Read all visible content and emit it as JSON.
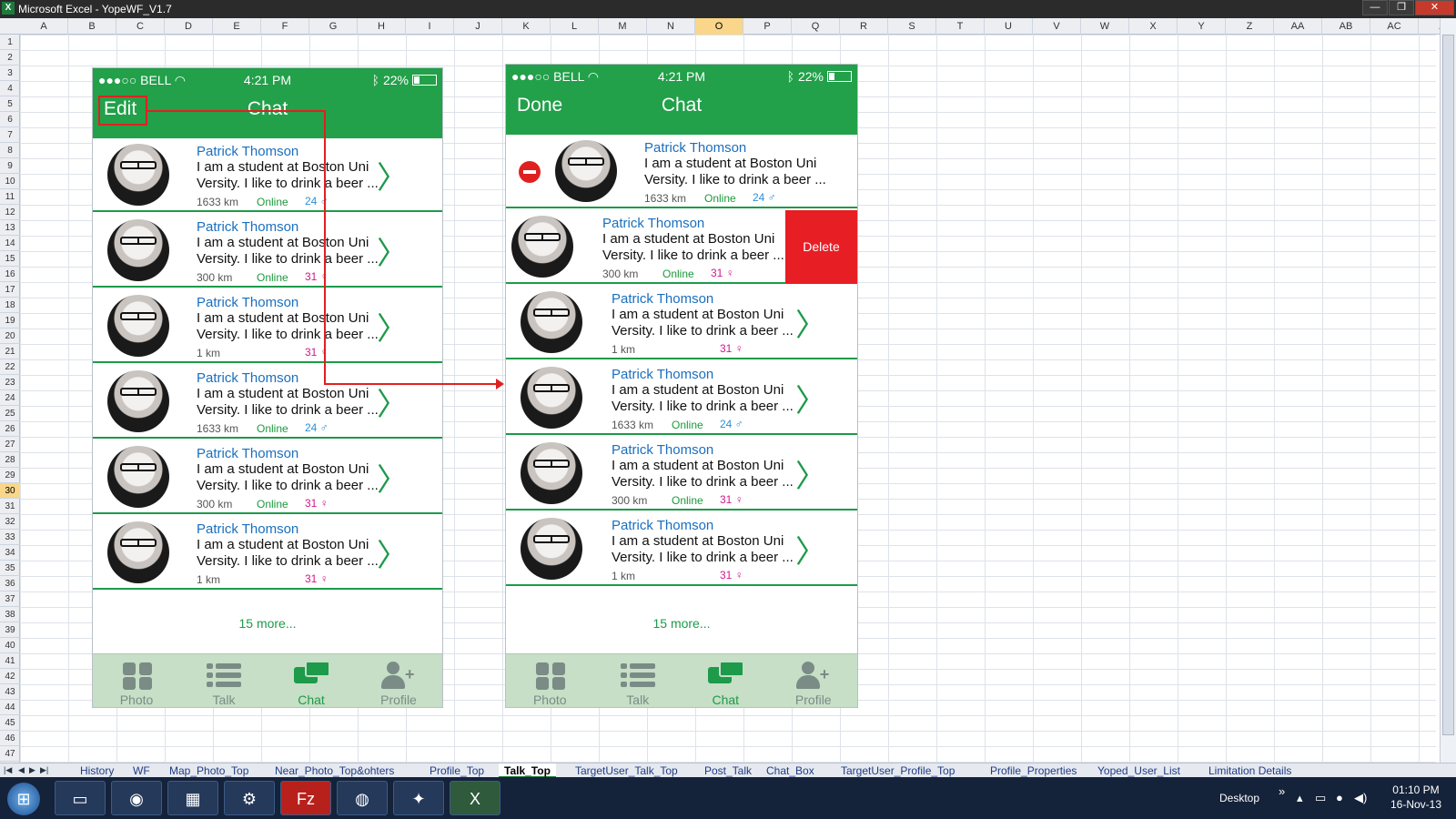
{
  "window": {
    "title": "Microsoft Excel - YopeWF_V1.7",
    "min_label": "—",
    "max_label": "❐",
    "close_label": "✕"
  },
  "spreadsheet": {
    "columns": [
      "A",
      "B",
      "C",
      "D",
      "E",
      "F",
      "G",
      "H",
      "I",
      "J",
      "K",
      "L",
      "M",
      "N",
      "O",
      "P",
      "Q",
      "R",
      "S",
      "T",
      "U",
      "V",
      "W",
      "X",
      "Y",
      "Z",
      "AA",
      "AB",
      "AC",
      "A"
    ],
    "selected_column": "O",
    "rows": [
      "1",
      "2",
      "3",
      "4",
      "5",
      "6",
      "7",
      "8",
      "9",
      "10",
      "11",
      "12",
      "13",
      "14",
      "15",
      "16",
      "17",
      "18",
      "19",
      "20",
      "21",
      "22",
      "23",
      "24",
      "25",
      "26",
      "27",
      "28",
      "29",
      "30",
      "31",
      "32",
      "33",
      "34",
      "35",
      "36",
      "37",
      "38",
      "39",
      "40",
      "41",
      "42",
      "43",
      "44",
      "45",
      "46",
      "47"
    ],
    "selected_row": "30"
  },
  "sheet_tabs": [
    "History",
    "WF",
    "Map_Photo_Top",
    "Near_Photo_Top&ohters",
    "Profile_Top",
    "Talk_Top",
    "TargetUser_Talk_Top",
    "Post_Talk",
    "Chat_Box",
    "TargetUser_Profile_Top",
    "Profile_Properties",
    "Yoped_User_List",
    "Limitation Details"
  ],
  "active_sheet": "Talk_Top",
  "taskbar": {
    "desktop_label": "Desktop",
    "clock_time": "01:10 PM",
    "clock_date": "16-Nov-13"
  },
  "phone_left": {
    "status": {
      "carrier": "●●●○○ BELL",
      "time": "4:21 PM",
      "battery": "22%"
    },
    "nav": {
      "left": "Edit",
      "title": "Chat"
    },
    "rows": [
      {
        "name": "Patrick Thomson",
        "msg1": "I am a student at Boston Uni",
        "msg2": "Versity. I like to drink a beer ...",
        "dist": "1633 km",
        "online": "Online",
        "age": "24 ♂",
        "gender": "m"
      },
      {
        "name": "Patrick Thomson",
        "msg1": "I am a student at Boston Uni",
        "msg2": "Versity. I like to drink a beer ...",
        "dist": "300 km",
        "online": "Online",
        "age": "31 ♀",
        "gender": "f"
      },
      {
        "name": "Patrick Thomson",
        "msg1": "I am a student at Boston Uni",
        "msg2": "Versity. I like to drink a beer ...",
        "dist": "1 km",
        "online": "",
        "age": "31 ♀",
        "gender": "f"
      },
      {
        "name": "Patrick Thomson",
        "msg1": "I am a student at Boston Uni",
        "msg2": "Versity. I like to drink a beer ...",
        "dist": "1633 km",
        "online": "Online",
        "age": "24 ♂",
        "gender": "m"
      },
      {
        "name": "Patrick Thomson",
        "msg1": "I am a student at Boston Uni",
        "msg2": "Versity. I like to drink a beer ...",
        "dist": "300 km",
        "online": "Online",
        "age": "31 ♀",
        "gender": "f"
      },
      {
        "name": "Patrick Thomson",
        "msg1": "I am a student at Boston Uni",
        "msg2": "Versity. I like to drink a beer ...",
        "dist": "1 km",
        "online": "",
        "age": "31 ♀",
        "gender": "f"
      }
    ],
    "more": "15 more...",
    "tabs": [
      "Photo",
      "Talk",
      "Chat",
      "Profile"
    ],
    "active_tab": "Chat"
  },
  "phone_right": {
    "status": {
      "carrier": "●●●○○ BELL",
      "time": "4:21 PM",
      "battery": "22%"
    },
    "nav": {
      "left": "Done",
      "title": "Chat"
    },
    "rows": [
      {
        "name": "Patrick Thomson",
        "msg1": "I am a student at Boston Uni",
        "msg2": "Versity. I like to drink a beer ...",
        "dist": "1633 km",
        "online": "Online",
        "age": "24 ♂",
        "gender": "m",
        "mode": "minus"
      },
      {
        "name": "Patrick Thomson",
        "msg1": "I am a student at Boston Uni",
        "msg2": "Versity. I like to drink a beer ...",
        "dist": "300 km",
        "online": "Online",
        "age": "31 ♀",
        "gender": "f",
        "mode": "delete"
      },
      {
        "name": "Patrick Thomson",
        "msg1": "I am a student at Boston Uni",
        "msg2": "Versity. I like to drink a beer ...",
        "dist": "1 km",
        "online": "",
        "age": "31 ♀",
        "gender": "f",
        "mode": "normal"
      },
      {
        "name": "Patrick Thomson",
        "msg1": "I am a student at Boston Uni",
        "msg2": "Versity. I like to drink a beer ...",
        "dist": "1633 km",
        "online": "Online",
        "age": "24 ♂",
        "gender": "m",
        "mode": "normal"
      },
      {
        "name": "Patrick Thomson",
        "msg1": "I am a student at Boston Uni",
        "msg2": "Versity. I like to drink a beer ...",
        "dist": "300 km",
        "online": "Online",
        "age": "31 ♀",
        "gender": "f",
        "mode": "normal"
      },
      {
        "name": "Patrick Thomson",
        "msg1": "I am a student at Boston Uni",
        "msg2": "Versity. I like to drink a beer ...",
        "dist": "1 km",
        "online": "",
        "age": "31 ♀",
        "gender": "f",
        "mode": "normal"
      }
    ],
    "delete_label": "Delete",
    "more": "15 more...",
    "tabs": [
      "Photo",
      "Talk",
      "Chat",
      "Profile"
    ],
    "active_tab": "Chat"
  },
  "colors": {
    "brand_green": "#22a04a",
    "delete_red": "#e81e25",
    "annotation_red": "#e02020",
    "name_blue": "#1a6fbf"
  }
}
